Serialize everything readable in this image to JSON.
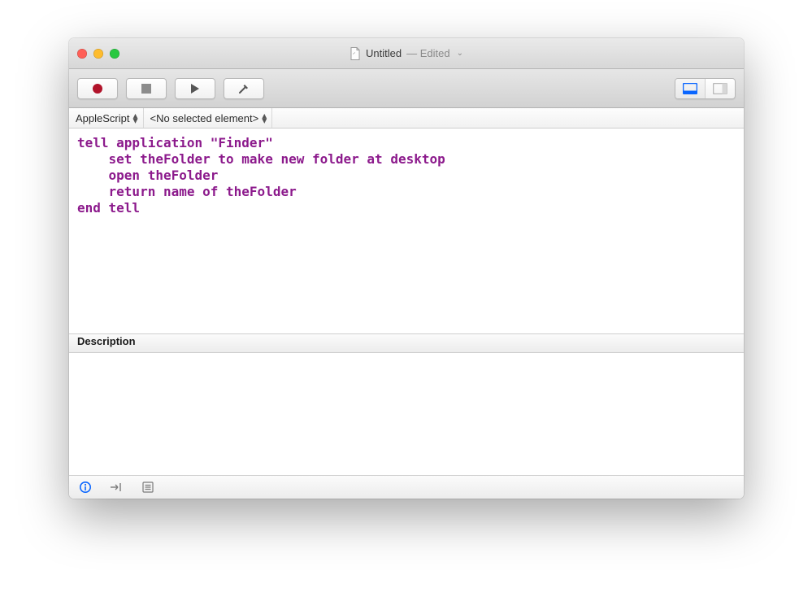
{
  "window": {
    "title": "Untitled",
    "title_suffix": "— Edited"
  },
  "nav": {
    "language": "AppleScript",
    "element": "<No selected element>"
  },
  "editor": {
    "code": "tell application \"Finder\"\n    set theFolder to make new folder at desktop\n    open theFolder\n    return name of theFolder\nend tell"
  },
  "panels": {
    "description_label": "Description",
    "description_body": ""
  },
  "colors": {
    "syntax_purple": "#8c1a8c",
    "record_red": "#b1132a",
    "accent_blue": "#0a66ff"
  }
}
